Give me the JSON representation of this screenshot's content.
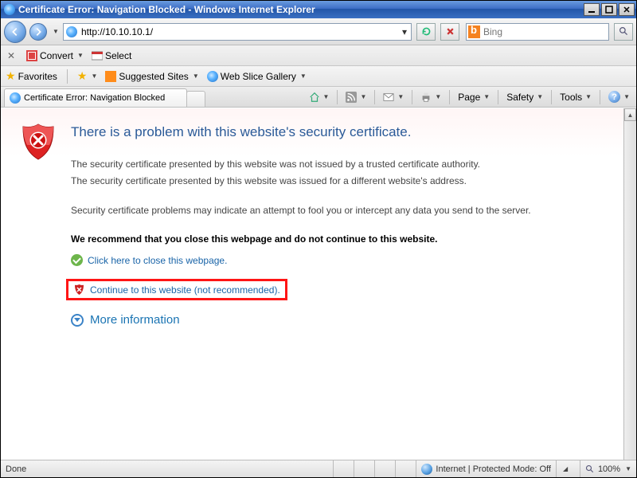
{
  "window": {
    "title": "Certificate Error: Navigation Blocked - Windows Internet Explorer"
  },
  "nav": {
    "url": "http://10.10.10.1/",
    "search_placeholder": "Bing"
  },
  "convertbar": {
    "convert": "Convert",
    "select": "Select"
  },
  "favbar": {
    "favorites": "Favorites",
    "suggested": "Suggested Sites",
    "webslice": "Web Slice Gallery"
  },
  "tab": {
    "title": "Certificate Error: Navigation Blocked"
  },
  "cmdbar": {
    "page": "Page",
    "safety": "Safety",
    "tools": "Tools"
  },
  "cert": {
    "heading": "There is a problem with this website's security certificate.",
    "p1": "The security certificate presented by this website was not issued by a trusted certificate authority.",
    "p2": "The security certificate presented by this website was issued for a different website's address.",
    "p3": "Security certificate problems may indicate an attempt to fool you or intercept any data you send to the server.",
    "recommend": "We recommend that you close this webpage and do not continue to this website.",
    "close_link": "Click here to close this webpage.",
    "continue_link": "Continue to this website (not recommended).",
    "more_info": "More information"
  },
  "status": {
    "done": "Done",
    "zone": "Internet | Protected Mode: Off",
    "zoom": "100%"
  }
}
